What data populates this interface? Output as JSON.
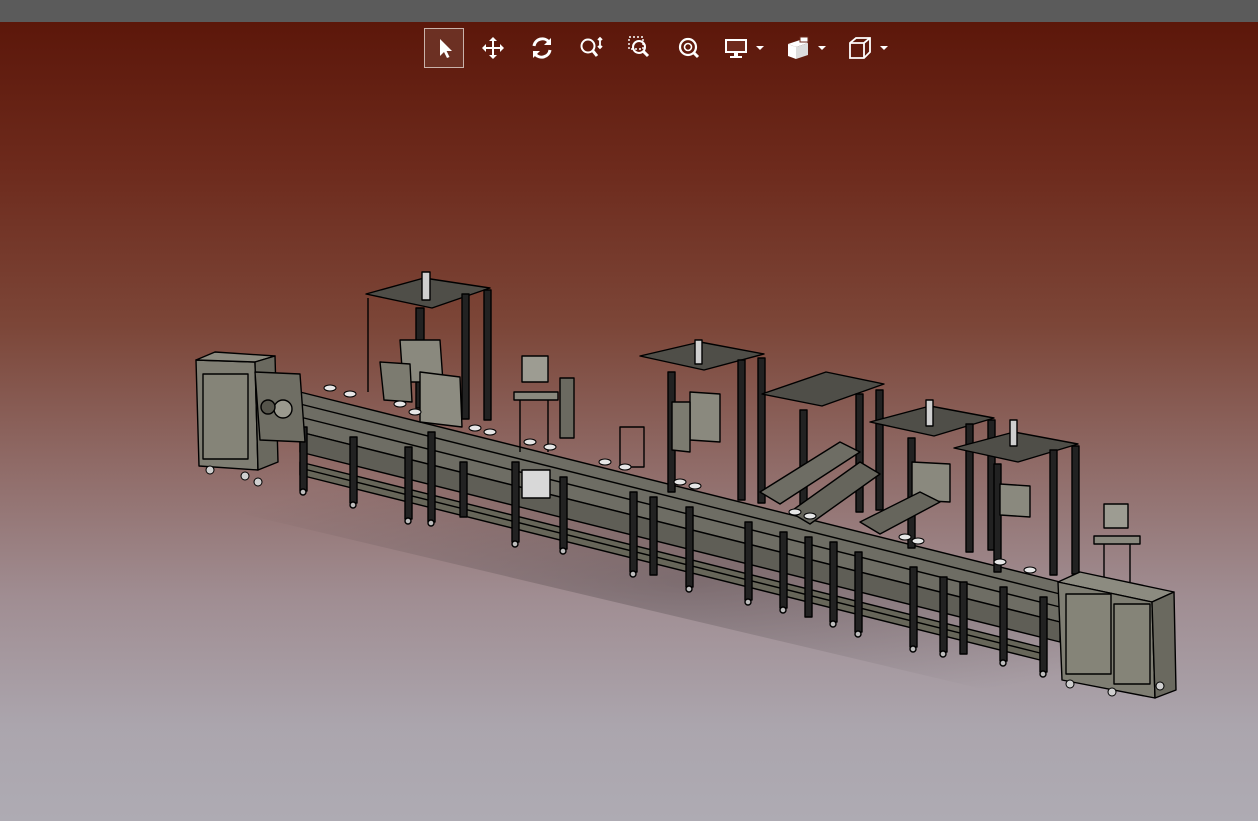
{
  "window": {
    "title": ""
  },
  "toolbar": {
    "buttons": [
      {
        "id": "select",
        "icon": "select-arrow-icon",
        "active": true
      },
      {
        "id": "pan",
        "icon": "pan-move-icon",
        "active": false
      },
      {
        "id": "rotate",
        "icon": "rotate-icon",
        "active": false
      },
      {
        "id": "zoom",
        "icon": "zoom-in-out-icon",
        "active": false
      },
      {
        "id": "zoom-area",
        "icon": "zoom-area-icon",
        "active": false
      },
      {
        "id": "fit-all",
        "icon": "fit-all-icon",
        "active": false
      }
    ],
    "dropdowns": [
      {
        "id": "display",
        "icon": "display-monitor-icon"
      },
      {
        "id": "render-style",
        "icon": "render-style-icon"
      },
      {
        "id": "view-orientation",
        "icon": "isometric-cube-icon"
      }
    ]
  },
  "viewport": {
    "background_top": "#5c170a",
    "background_bottom": "#aeabb3",
    "model_fill": "#7b7a70",
    "model_edge": "#000000",
    "model_highlight": "#d9d9d9"
  }
}
